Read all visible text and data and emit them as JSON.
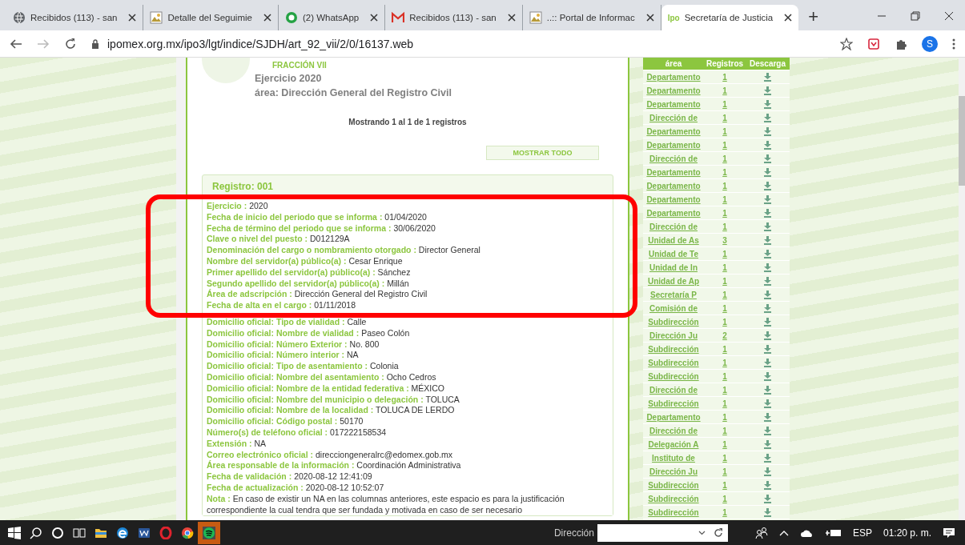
{
  "browser": {
    "tabs": [
      {
        "title": "Recibidos (113) - san",
        "kind": "globe",
        "selected": false
      },
      {
        "title": "Detalle del Seguimie",
        "kind": "picture",
        "selected": false
      },
      {
        "title": "(2) WhatsApp",
        "kind": "chat",
        "selected": false
      },
      {
        "title": "Recibidos (113) - san",
        "kind": "mail",
        "selected": false
      },
      {
        "title": "..:: Portal de Informac",
        "kind": "picture",
        "selected": false
      },
      {
        "title": "Secretaría de Justicia",
        "kind": "text",
        "favicon_text": "Ipo",
        "selected": true
      }
    ],
    "new_tab": "+",
    "url": "ipomex.org.mx/ipo3/lgt/indice/SJDH/art_92_vii/2/0/16137.web",
    "avatar": "S"
  },
  "page": {
    "fraccion": "FRACCIÓN VII",
    "ejercicio": "Ejercicio 2020",
    "area": "área: Dirección General del Registro Civil",
    "showing": "Mostrando 1 al 1 de 1 registros",
    "show_all_button": "MOSTRAR TODO",
    "record": {
      "title": "Registro: 001",
      "fields": [
        {
          "label": "Ejercicio :",
          "value": "2020"
        },
        {
          "label": "Fecha de inicio del periodo que se informa :",
          "value": "01/04/2020"
        },
        {
          "label": "Fecha de término del periodo que se informa :",
          "value": "30/06/2020"
        },
        {
          "label": "Clave o nivel del puesto :",
          "value": "D012129A"
        },
        {
          "label": "Denominación del cargo o nombramiento otorgado :",
          "value": "Director General"
        },
        {
          "label": "Nombre del servidor(a) público(a) :",
          "value": "Cesar Enrique"
        },
        {
          "label": "Primer apellido del servidor(a) público(a) :",
          "value": "Sánchez"
        },
        {
          "label": "Segundo apellido del servidor(a) público(a) :",
          "value": "Millán"
        },
        {
          "label": "Área de adscripción :",
          "value": "Dirección General del Registro Civil"
        },
        {
          "label": "Fecha de alta en el cargo :",
          "value": "01/11/2018"
        },
        {
          "label": "Domicilio oficial: Tipo de vialidad :",
          "value": "Calle"
        },
        {
          "label": "Domicilio oficial: Nombre de vialidad :",
          "value": "Paseo Colón"
        },
        {
          "label": "Domicilio oficial: Número Exterior :",
          "value": "No. 800"
        },
        {
          "label": "Domicilio oficial: Número interior :",
          "value": "NA"
        },
        {
          "label": "Domicilio oficial: Tipo de asentamiento :",
          "value": "Colonia"
        },
        {
          "label": "Domicilio oficial: Nombre del asentamiento :",
          "value": "Ocho Cedros"
        },
        {
          "label": "Domicilio oficial: Nombre de la entidad federativa :",
          "value": "MÉXICO"
        },
        {
          "label": "Domicilio oficial: Nombre del municipio o delegación :",
          "value": "TOLUCA"
        },
        {
          "label": "Domicilio oficial: Nombre de la localidad :",
          "value": "TOLUCA DE LERDO"
        },
        {
          "label": "Domicilio oficial: Código postal :",
          "value": "50170"
        },
        {
          "label": "Número(s) de teléfono oficial :",
          "value": "017222158534"
        },
        {
          "label": "Extensión :",
          "value": "NA"
        },
        {
          "label": "Correo electrónico oficial :",
          "value": "direcciongeneralrc@edomex.gob.mx"
        },
        {
          "label": "Área responsable de la información :",
          "value": "Coordinación Administrativa"
        },
        {
          "label": "Fecha de validación :",
          "value": "2020-08-12 12:41:09"
        },
        {
          "label": "Fecha de actualización :",
          "value": "2020-08-12 10:52:07"
        },
        {
          "label": "Nota :",
          "value": "En caso de existir un NA en las columnas anteriores, este espacio es para la justificación correspondiente la cual tendra que ser fundada y motivada en caso de ser necesario"
        }
      ]
    }
  },
  "area_table": {
    "columns": [
      "área",
      "Registros",
      "Descarga"
    ],
    "rows": [
      {
        "area": "Departamento",
        "registros": "1"
      },
      {
        "area": "Departamento",
        "registros": "1"
      },
      {
        "area": "Departamento",
        "registros": "1"
      },
      {
        "area": "Dirección de",
        "registros": "1"
      },
      {
        "area": "Departamento",
        "registros": "1"
      },
      {
        "area": "Departamento",
        "registros": "1"
      },
      {
        "area": "Dirección de",
        "registros": "1"
      },
      {
        "area": "Departamento",
        "registros": "1"
      },
      {
        "area": "Departamento",
        "registros": "1"
      },
      {
        "area": "Departamento",
        "registros": "1"
      },
      {
        "area": "Departamento",
        "registros": "1"
      },
      {
        "area": "Dirección de",
        "registros": "1"
      },
      {
        "area": "Unidad de As",
        "registros": "3"
      },
      {
        "area": "Unidad de Te",
        "registros": "1"
      },
      {
        "area": "Unidad de In",
        "registros": "1"
      },
      {
        "area": "Unidad de Ap",
        "registros": "1"
      },
      {
        "area": "Secretaría P",
        "registros": "1"
      },
      {
        "area": "Comisión de",
        "registros": "1"
      },
      {
        "area": "Subdirección",
        "registros": "1"
      },
      {
        "area": "Dirección Ju",
        "registros": "2"
      },
      {
        "area": "Subdirección",
        "registros": "1"
      },
      {
        "area": "Subdirección",
        "registros": "1"
      },
      {
        "area": "Subdirección",
        "registros": "1"
      },
      {
        "area": "Dirección de",
        "registros": "1"
      },
      {
        "area": "Subdirección",
        "registros": "1"
      },
      {
        "area": "Departamento",
        "registros": "1"
      },
      {
        "area": "Dirección de",
        "registros": "1"
      },
      {
        "area": "Delegación A",
        "registros": "1"
      },
      {
        "area": "Instituto de",
        "registros": "1"
      },
      {
        "area": "Dirección Ju",
        "registros": "1"
      },
      {
        "area": "Subdirección",
        "registros": "1"
      },
      {
        "area": "Subdirección",
        "registros": "1"
      },
      {
        "area": "Subdirección",
        "registros": "1"
      }
    ]
  },
  "taskbar": {
    "address_label": "Dirección",
    "language": "ESP",
    "time": "01:20 p. m."
  }
}
